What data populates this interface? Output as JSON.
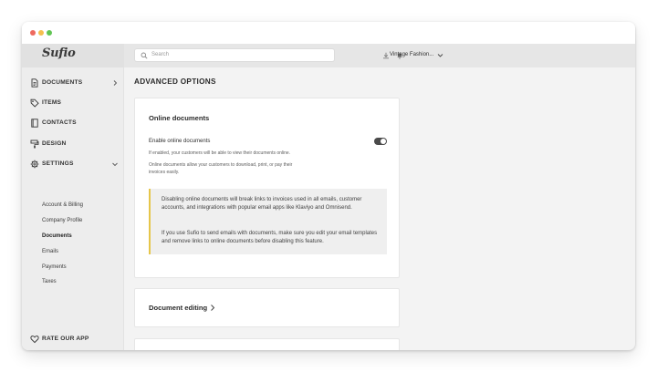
{
  "app": {
    "logo_text": "Sufio"
  },
  "sidebar": {
    "items": [
      {
        "label": "DOCUMENTS",
        "icon": "document-icon"
      },
      {
        "label": "ITEMS",
        "icon": "tag-icon"
      },
      {
        "label": "CONTACTS",
        "icon": "address-book-icon"
      },
      {
        "label": "DESIGN",
        "icon": "paint-roller-icon"
      },
      {
        "label": "SETTINGS",
        "icon": "gear-icon"
      }
    ],
    "settings_sub": [
      {
        "label": "Account & Billing"
      },
      {
        "label": "Company Profile"
      },
      {
        "label": "Documents",
        "active": true
      },
      {
        "label": "Emails"
      },
      {
        "label": "Payments"
      },
      {
        "label": "Taxes"
      }
    ],
    "rate_label": "RATE OUR APP"
  },
  "topbar": {
    "search_placeholder": "Search",
    "store_name": "Vintage Fashion..."
  },
  "main": {
    "page_title": "ADVANCED OPTIONS",
    "online_documents": {
      "title": "Online documents",
      "setting_label": "Enable online documents",
      "toggle_on": true,
      "help1": "If enabled, your customers will be able to view their documents online.",
      "help2": "Online documents allow your customers to download, print, or pay their invoices easily.",
      "notice_p1": "Disabling online documents will break links to invoices used in all emails, customer accounts, and integrations with popular email apps like Klaviyo and Omnisend.",
      "notice_p2": "If you use Sufio to send emails with documents, make sure you edit your email templates and remove links to online documents before disabling this feature."
    },
    "document_editing": {
      "title": "Document editing"
    }
  },
  "colors": {
    "notice_accent": "#e6c64a",
    "toggle_on": "#4a4a4a",
    "window_dot_red": "#ee6a5f",
    "window_dot_yellow": "#f5bf4f",
    "window_dot_green": "#61c554"
  }
}
